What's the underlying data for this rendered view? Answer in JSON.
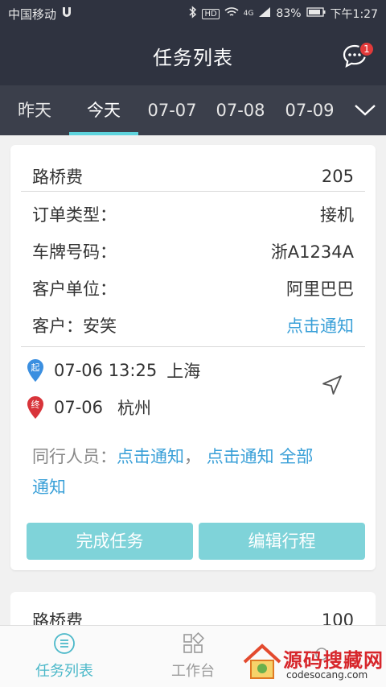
{
  "status": {
    "carrier": "中国移动",
    "network": "4G",
    "battery": "83%",
    "time": "下午1:27"
  },
  "header": {
    "title": "任务列表",
    "badge": "1"
  },
  "tabs": [
    {
      "label": "昨天"
    },
    {
      "label": "今天"
    },
    {
      "label": "07-07"
    },
    {
      "label": "07-08"
    },
    {
      "label": "07-09"
    }
  ],
  "card": {
    "toll_label": "路桥费",
    "toll_value": "205",
    "order_type_label": "订单类型：",
    "order_type_value": "接机",
    "plate_label": "车牌号码：",
    "plate_value": "浙A1234A",
    "company_label": "客户单位：",
    "company_value": "阿里巴巴",
    "customer_label": "客户：安笑",
    "notify_link": "点击通知",
    "start_pin": "起",
    "start_time": "07-06 13:25",
    "start_place": "上海",
    "end_pin": "终",
    "end_time": "07-06",
    "end_place": "杭州",
    "companions_label": "同行人员：",
    "companion_1": "点击通知",
    "companion_sep": "，",
    "companion_2": "点击通知",
    "notify_all_1": "全部",
    "notify_all_2": "通知",
    "complete_button": "完成任务",
    "edit_button": "编辑行程"
  },
  "card2": {
    "toll_label": "路桥费",
    "toll_value": "100"
  },
  "bottom_nav": [
    {
      "label": "任务列表",
      "icon": "list-icon"
    },
    {
      "label": "工作台",
      "icon": "grid-icon"
    }
  ],
  "watermark": {
    "main": "源码搜藏网",
    "sub": "codesocang.com"
  },
  "colors": {
    "header_bg": "#2f3340",
    "tab_bg": "#3b3f4b",
    "accent": "#5dd3dc",
    "link": "#3aa0d8",
    "button": "#7fd3d9",
    "badge": "#e23a3a"
  }
}
